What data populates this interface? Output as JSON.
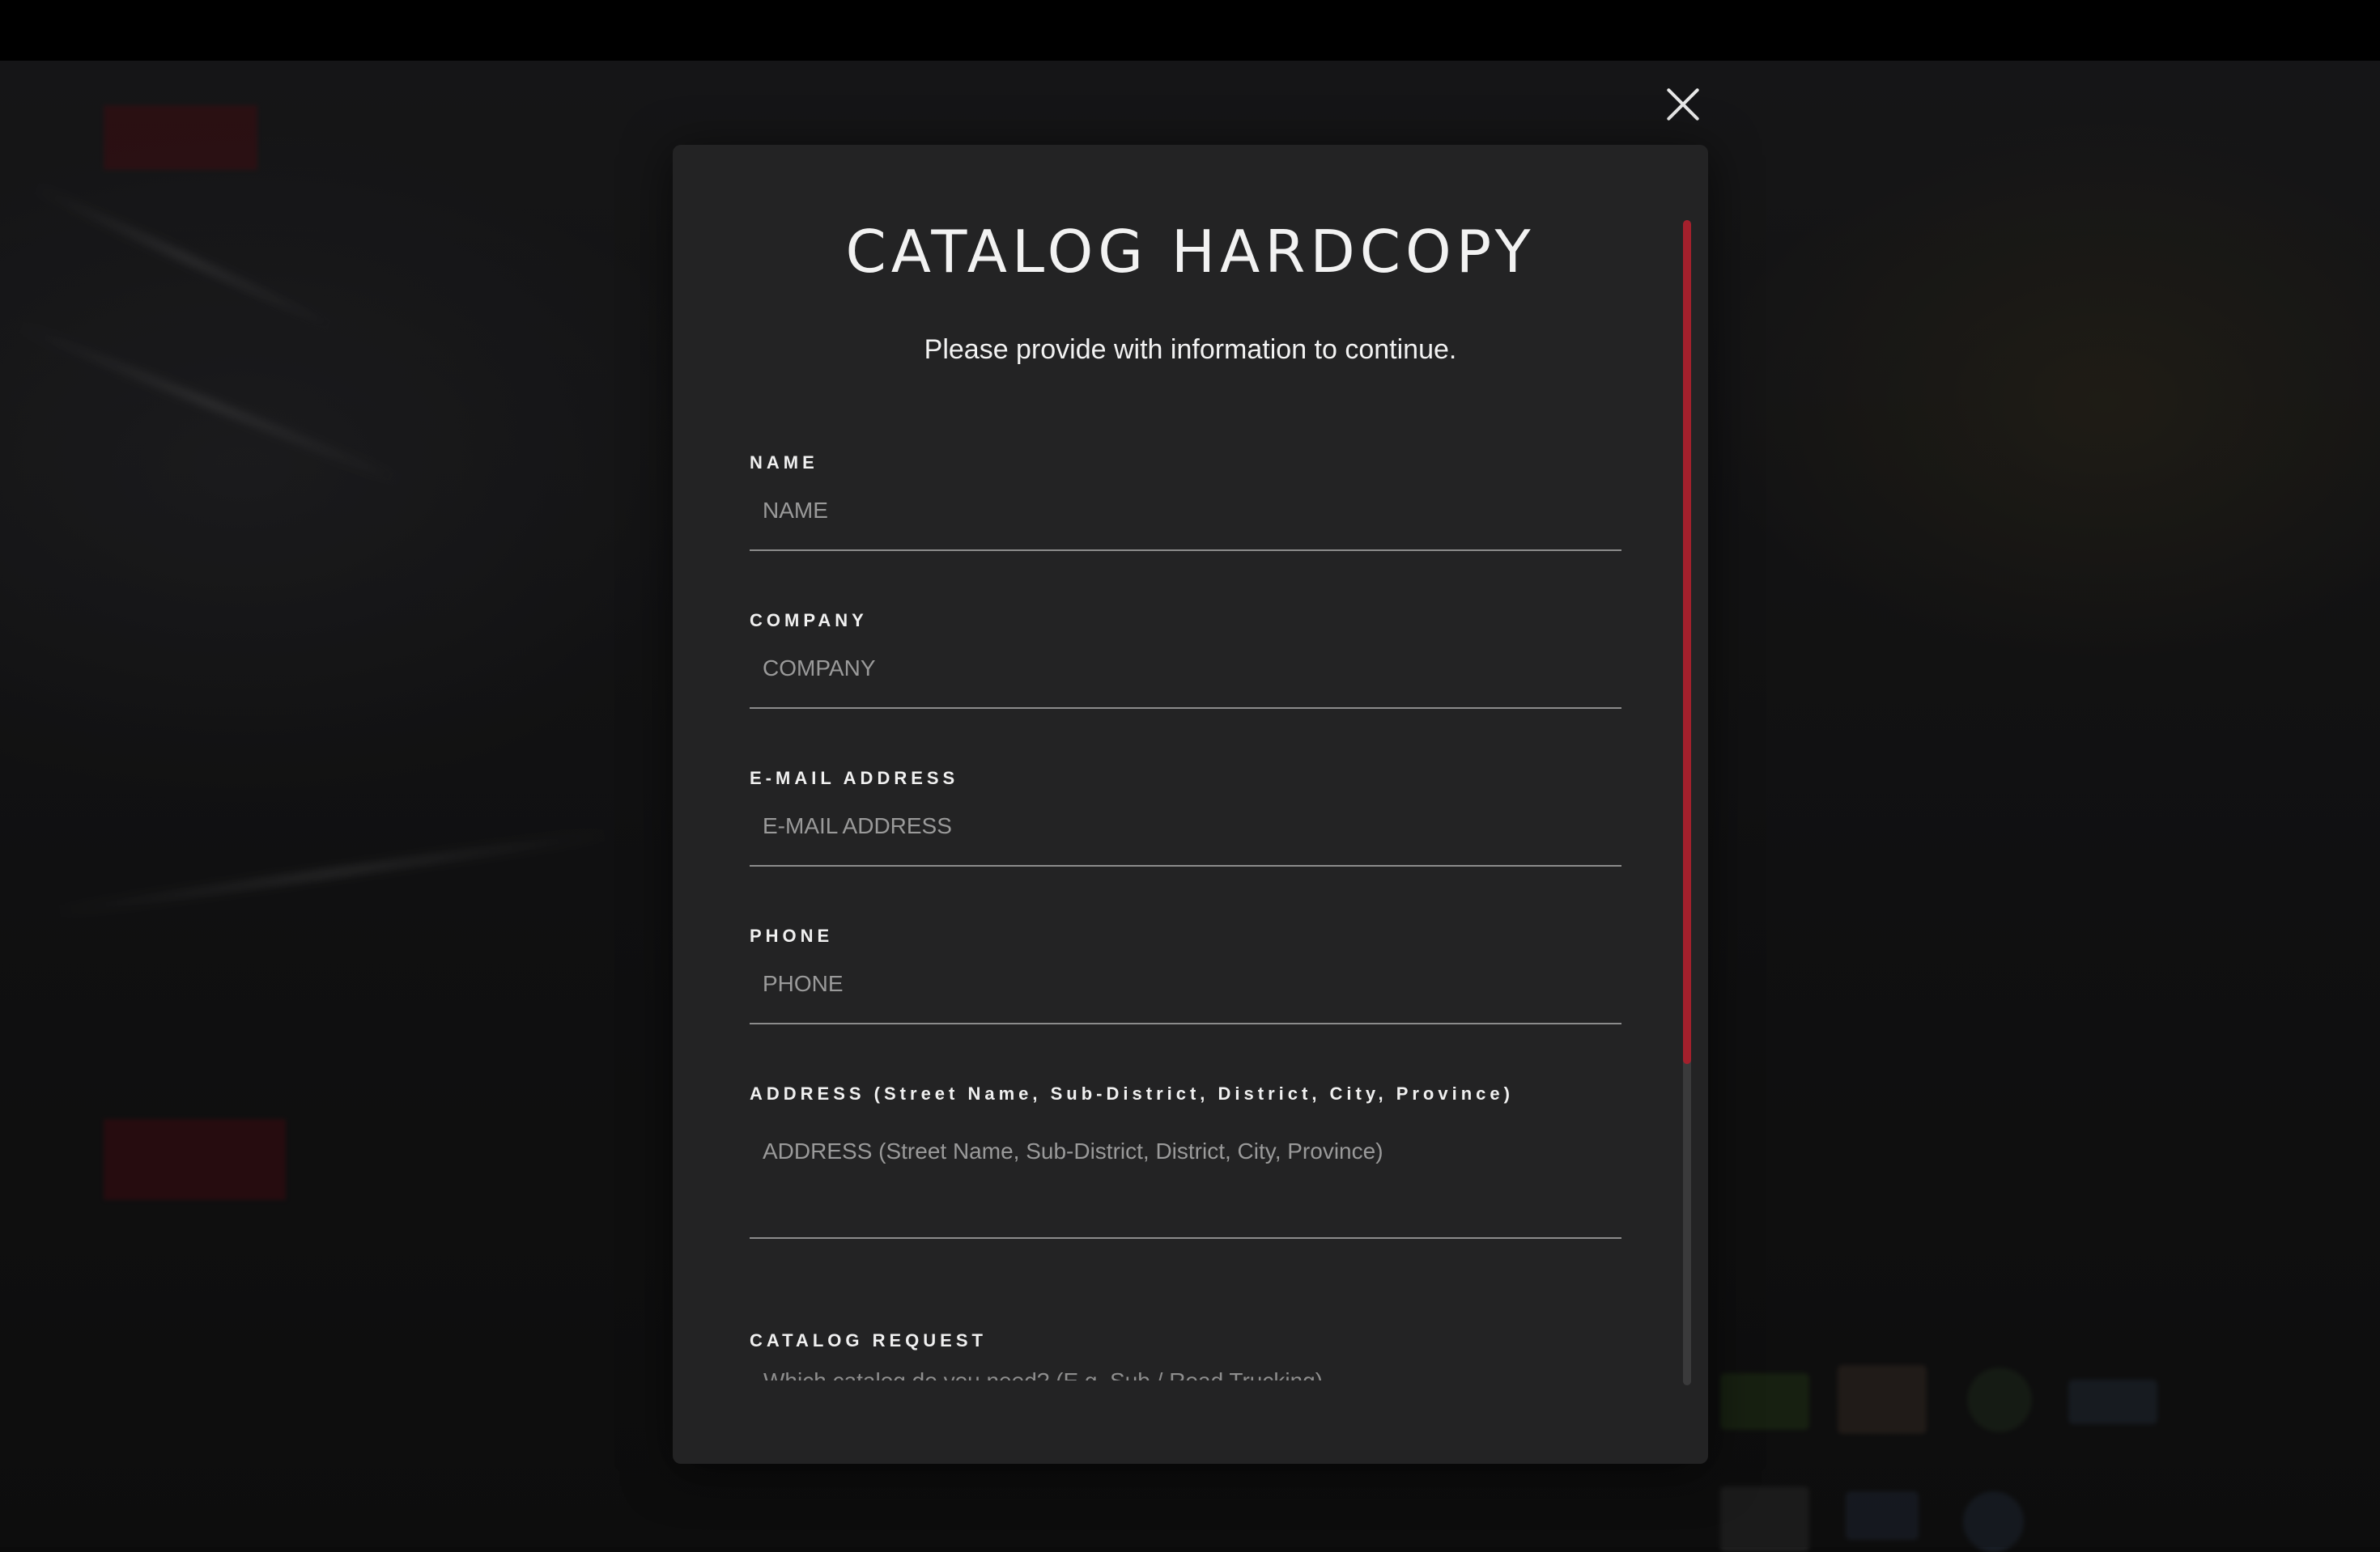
{
  "modal": {
    "title": "CATALOG HARDCOPY",
    "subtitle": "Please provide with information to continue.",
    "fields": [
      {
        "label": "NAME",
        "placeholder": "NAME"
      },
      {
        "label": "COMPANY",
        "placeholder": "COMPANY"
      },
      {
        "label": "E-MAIL ADDRESS",
        "placeholder": "E-MAIL ADDRESS"
      },
      {
        "label": "PHONE",
        "placeholder": "PHONE"
      },
      {
        "label": "ADDRESS (Street Name, Sub-District, District, City, Province)",
        "placeholder": "ADDRESS (Street Name, Sub-District, District, City, Province)"
      }
    ],
    "catalog_request": {
      "label": "CATALOG REQUEST",
      "partial_text": "Which catalog do you need? (E.g. Sub / Road Trucking)"
    }
  },
  "colors": {
    "modal_bg": "#232324",
    "accent": "#a3202c",
    "page_bg": "#0b0b0b"
  },
  "icons": {
    "close": "close-icon"
  }
}
